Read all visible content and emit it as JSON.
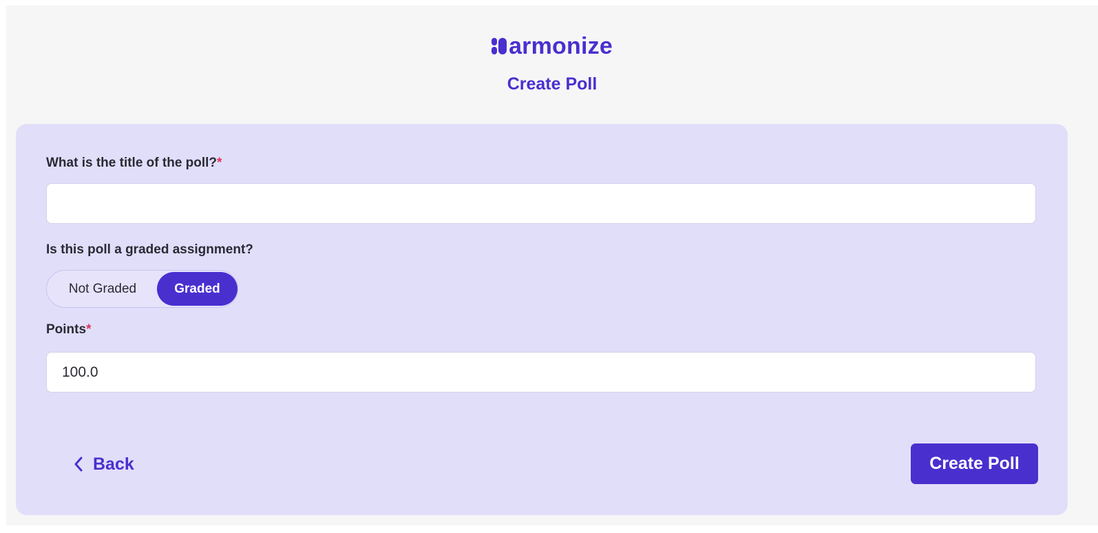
{
  "brand": {
    "logo_text": "armonize",
    "accent_color": "#4a2fcf"
  },
  "header": {
    "subtitle": "Create Poll"
  },
  "form": {
    "title_label": "What is the title of the poll?",
    "required_marker": "*",
    "title_value": "",
    "graded_question": "Is this poll a graded assignment?",
    "toggle": {
      "options": [
        "Not Graded",
        "Graded"
      ],
      "selected": "Graded"
    },
    "points_label": "Points",
    "points_value": "100.0"
  },
  "actions": {
    "back_label": "Back",
    "back_icon": "chevron-left-icon",
    "create_label": "Create Poll"
  }
}
